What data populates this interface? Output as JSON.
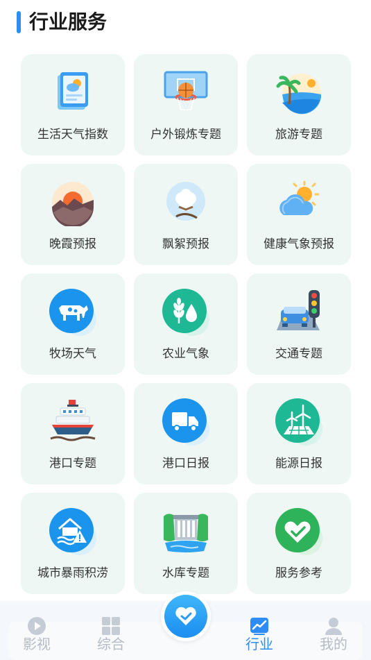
{
  "header": {
    "title": "行业服务"
  },
  "colors": {
    "accent": "#2f8cf5",
    "card_bg": "#eef7f4",
    "nav_inactive": "#b5bcc6"
  },
  "services": [
    {
      "label": "生活天气指数",
      "icon": "weather-index-icon"
    },
    {
      "label": "户外锻炼专题",
      "icon": "basketball-hoop-icon"
    },
    {
      "label": "旅游专题",
      "icon": "beach-palm-icon"
    },
    {
      "label": "晚霞预报",
      "icon": "sunset-icon"
    },
    {
      "label": "飘絮预报",
      "icon": "cotton-catkin-icon"
    },
    {
      "label": "健康气象预报",
      "icon": "sun-cloud-icon"
    },
    {
      "label": "牧场天气",
      "icon": "cow-icon"
    },
    {
      "label": "农业气象",
      "icon": "wheat-drop-icon"
    },
    {
      "label": "交通专题",
      "icon": "traffic-light-car-icon"
    },
    {
      "label": "港口专题",
      "icon": "ship-icon"
    },
    {
      "label": "港口日报",
      "icon": "truck-icon"
    },
    {
      "label": "能源日报",
      "icon": "wind-solar-icon"
    },
    {
      "label": "城市暴雨积涝",
      "icon": "flood-warning-icon"
    },
    {
      "label": "水库专题",
      "icon": "dam-icon"
    },
    {
      "label": "服务参考",
      "icon": "heart-handshake-icon"
    }
  ],
  "bottom_nav": {
    "items": [
      {
        "label": "影视",
        "icon": "play-icon",
        "active": false
      },
      {
        "label": "综合",
        "icon": "grid-icon",
        "active": false
      },
      {
        "label": "行业",
        "icon": "chart-icon",
        "active": true
      },
      {
        "label": "我的",
        "icon": "user-icon",
        "active": false
      }
    ],
    "center": {
      "icon": "heart-icon"
    }
  }
}
